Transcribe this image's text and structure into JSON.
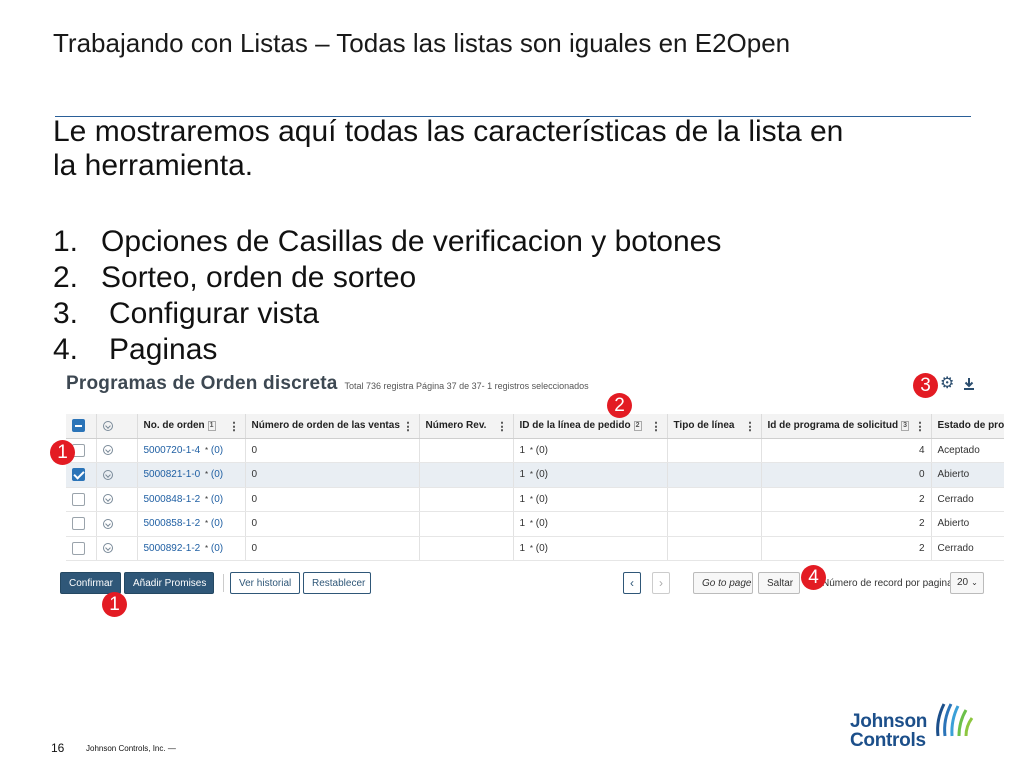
{
  "slide": {
    "title": "Trabajando con Listas – Todas las listas son iguales en E2Open",
    "intro_line1": "Le mostraremos aquí todas las características de la lista en",
    "intro_line2": "la herramienta.",
    "items": [
      {
        "num": "1.",
        "text": "Opciones de Casillas de verificacion y botones"
      },
      {
        "num": "2.",
        "text": "Sorteo, orden de sorteo"
      },
      {
        "num": "3.",
        "text": "Configurar vista"
      },
      {
        "num": "4.",
        "text": "Paginas"
      }
    ],
    "page_number": "16",
    "company": "Johnson Controls, Inc. —",
    "logo_line1": "Johnson",
    "logo_line2": "Controls"
  },
  "screen": {
    "title": "Programas de Orden discreta",
    "subtitle": "Total 736 registra Página 37 de 37- 1 registros seleccionados",
    "columns": [
      {
        "label": "No. de orden",
        "sort": "1"
      },
      {
        "label": "Número de orden de las ventas",
        "sort": ""
      },
      {
        "label": "Número Rev.",
        "sort": ""
      },
      {
        "label": "ID de la línea de pedido",
        "sort": "2"
      },
      {
        "label": "Tipo de línea",
        "sort": ""
      },
      {
        "label": "Id de programa de solicitud",
        "sort": "3"
      },
      {
        "label": "Estado de prog",
        "sort": ""
      }
    ],
    "rows": [
      {
        "order": "5000720-1-4",
        "star": "*",
        "count": "(0)",
        "sales": "0",
        "rev": "",
        "line": "1",
        "line_count": "(0)",
        "type": "",
        "req": "4",
        "status": "Aceptado"
      },
      {
        "order": "5000821-1-0",
        "star": "*",
        "count": "(0)",
        "sales": "0",
        "rev": "",
        "line": "1",
        "line_count": "(0)",
        "type": "",
        "req": "0",
        "status": "Abierto"
      },
      {
        "order": "5000848-1-2",
        "star": "*",
        "count": "(0)",
        "sales": "0",
        "rev": "",
        "line": "1",
        "line_count": "(0)",
        "type": "",
        "req": "2",
        "status": "Cerrado"
      },
      {
        "order": "5000858-1-2",
        "star": "*",
        "count": "(0)",
        "sales": "0",
        "rev": "",
        "line": "1",
        "line_count": "(0)",
        "type": "",
        "req": "2",
        "status": "Abierto"
      },
      {
        "order": "5000892-1-2",
        "star": "*",
        "count": "(0)",
        "sales": "0",
        "rev": "",
        "line": "1",
        "line_count": "(0)",
        "type": "",
        "req": "2",
        "status": "Cerrado"
      }
    ],
    "buttons": {
      "confirm": "Confirmar",
      "add_promises": "Añadir Promises",
      "view_history": "Ver historial",
      "reset": "Restablecer",
      "prev": "‹",
      "next": "›",
      "go_to_page": "Go to page",
      "jump": "Saltar"
    },
    "per_page_label": "Número de record por pagina",
    "per_page_value": "20"
  },
  "callouts": [
    "1",
    "2",
    "3",
    "4",
    "1"
  ],
  "colors": {
    "callout": "#e31b23",
    "button_dark": "#2f5778",
    "link": "#1f5fa3",
    "checkbox": "#2b74b8",
    "brand": "#1c4f8a"
  }
}
